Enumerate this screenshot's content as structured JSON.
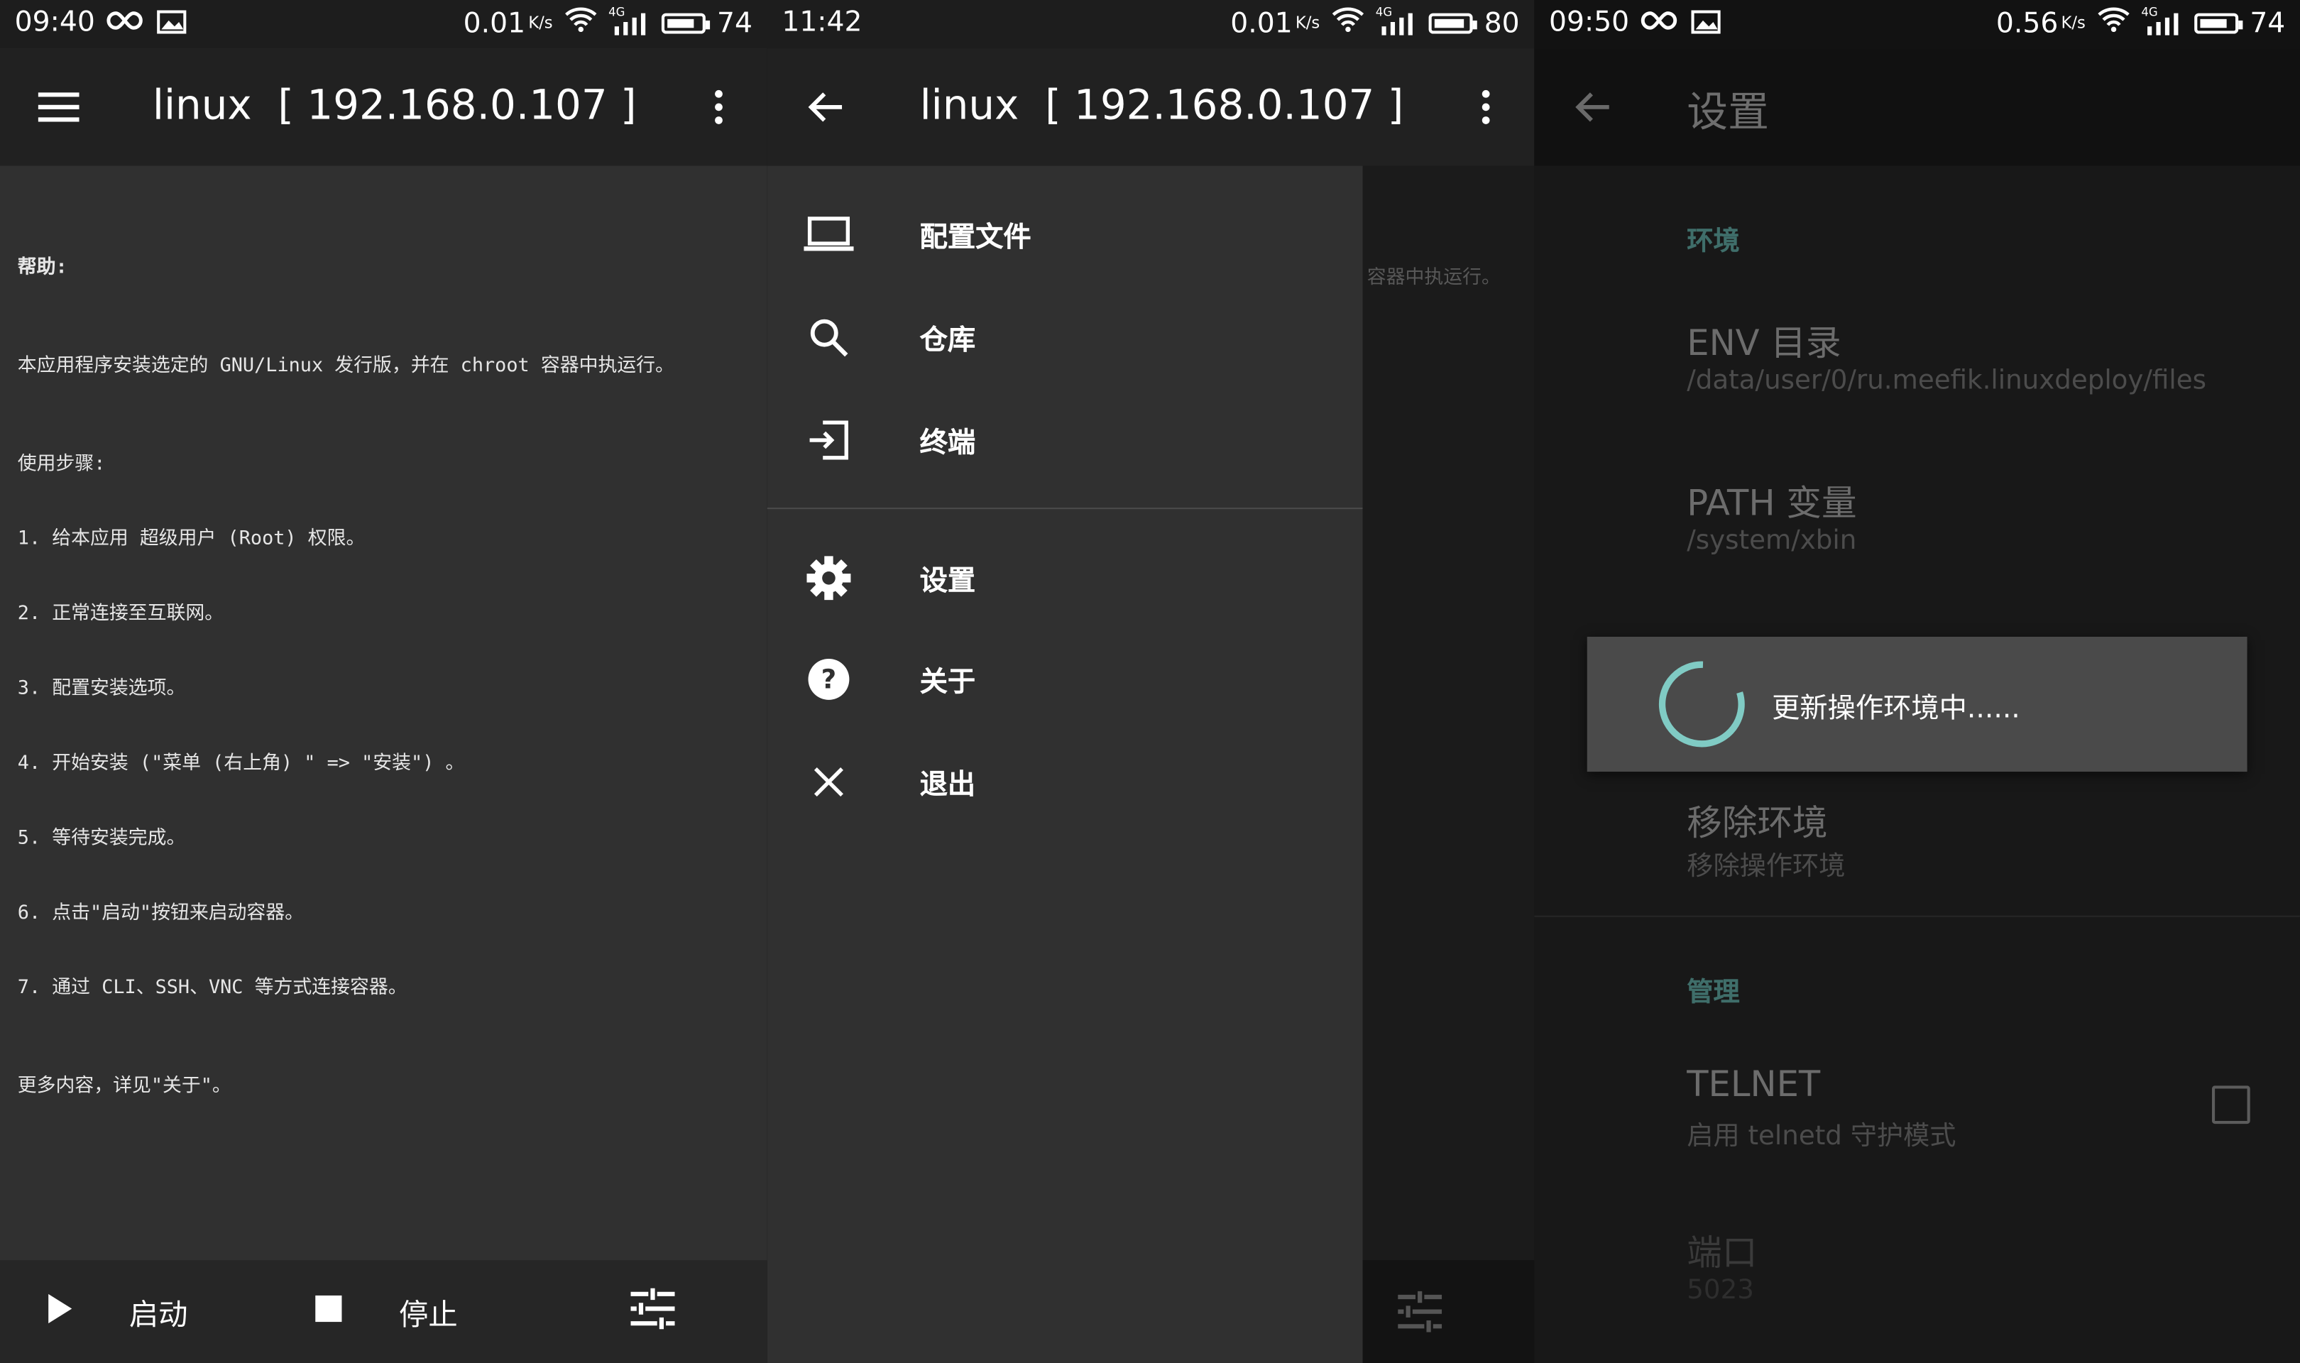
{
  "panel1": {
    "status": {
      "time": "09:40",
      "net_speed": "0.01",
      "net_unit": "K/s",
      "signal": "4G",
      "battery": "74"
    },
    "toolbar": {
      "title": "linux  [ 192.168.0.107 ]",
      "menu_icon": "hamburger-menu-icon",
      "more_icon": "more-vert-icon"
    },
    "help": {
      "title": "帮助:",
      "intro": "本应用程序安装选定的 GNU/Linux 发行版，并在 chroot 容器中执运行。",
      "steps_title": "使用步骤:",
      "steps": [
        "1. 给本应用 超级用户 (Root) 权限。",
        "2. 正常连接至互联网。",
        "3. 配置安装选项。",
        "4. 开始安装 (\"菜单 (右上角) \" => \"安装\") 。",
        "5. 等待安装完成。",
        "6. 点击\"启动\"按钮来启动容器。",
        "7. 通过 CLI、SSH、VNC 等方式连接容器。"
      ],
      "more": "更多内容，详见\"关于\"。"
    },
    "bottom": {
      "start_label": "启动",
      "stop_label": "停止"
    }
  },
  "panel2": {
    "status": {
      "time": "11:42",
      "net_speed": "0.01",
      "net_unit": "K/s",
      "signal": "4G",
      "battery": "80"
    },
    "toolbar": {
      "title": "linux  [ 192.168.0.107 ]",
      "back_icon": "arrow-back-icon",
      "more_icon": "more-vert-icon"
    },
    "drawer": {
      "items": [
        {
          "label": "配置文件",
          "icon": "laptop-icon"
        },
        {
          "label": "仓库",
          "icon": "search-icon"
        },
        {
          "label": "终端",
          "icon": "login-icon"
        },
        {
          "label": "设置",
          "icon": "gear-icon"
        },
        {
          "label": "关于",
          "icon": "help-circle-icon"
        },
        {
          "label": "退出",
          "icon": "close-icon"
        }
      ]
    },
    "scrim_text": "容器中执运行。"
  },
  "panel3": {
    "status": {
      "time": "09:50",
      "net_speed": "0.56",
      "net_unit": "K/s",
      "signal": "4G",
      "battery": "74"
    },
    "toolbar": {
      "title": "设置",
      "back_icon": "arrow-back-icon"
    },
    "env_category": "环境",
    "env_dir": {
      "title": "ENV 目录",
      "summary": "/data/user/0/ru.meefik.linuxdeploy/files"
    },
    "path_var": {
      "title": "PATH 变量",
      "summary": "/system/xbin"
    },
    "remove_env": {
      "title": "移除环境",
      "summary": "移除操作环境"
    },
    "manage_category": "管理",
    "telnet": {
      "title": "TELNET",
      "summary": "启用 telnetd 守护模式",
      "checked": false
    },
    "port": {
      "title": "端口",
      "summary": "5023"
    },
    "dialog": {
      "message": "更新操作环境中......",
      "spinner_color": "#80cbc4"
    }
  },
  "colors": {
    "accent": "#80cbc4",
    "category": "#3f6e6a",
    "surface": "#303030",
    "toolbar": "#212121"
  }
}
